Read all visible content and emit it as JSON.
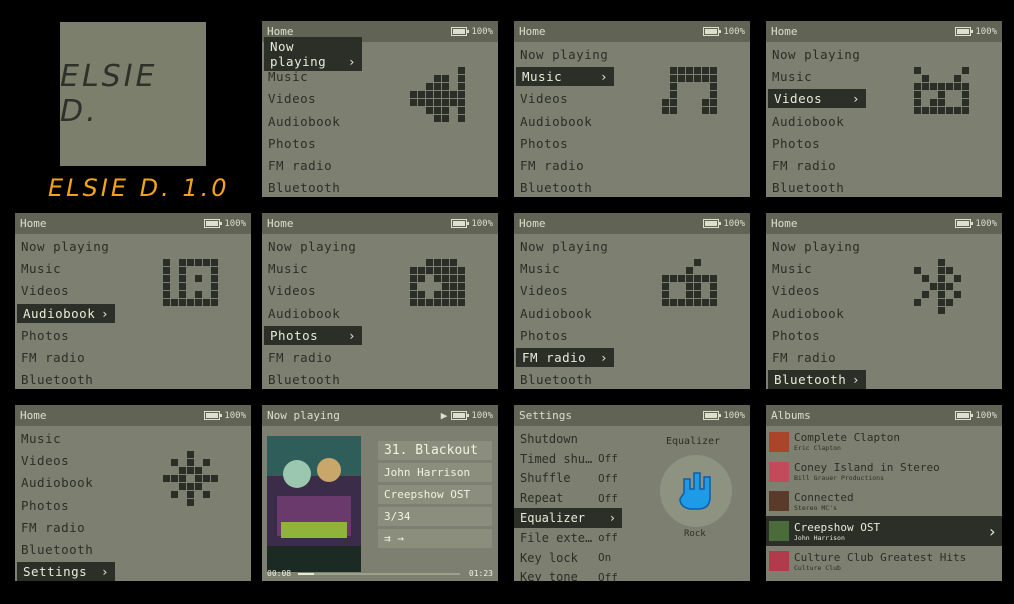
{
  "logo": {
    "screen_text": "ELSIE D.",
    "version_text": "ELSIE D. 1.0"
  },
  "colors": {
    "lcd": "#7d8070",
    "header": "#616454",
    "ink": "#2b2e27",
    "selection": "#2c2f28",
    "version": "#f2a31a"
  },
  "battery": "100%",
  "home": {
    "title": "Home",
    "items": [
      "Now playing",
      "Music",
      "Videos",
      "Audiobook",
      "Photos",
      "FM radio",
      "Bluetooth"
    ],
    "items_scrolled": [
      "Music",
      "Videos",
      "Audiobook",
      "Photos",
      "FM radio",
      "Bluetooth",
      "Settings"
    ]
  },
  "icons": [
    "speaker-icon",
    "music-note-icon",
    "tv-icon",
    "audiobook-icon",
    "camera-icon",
    "radio-icon",
    "bluetooth-icon",
    "settings-gear-icon"
  ],
  "now_playing": {
    "title": "Now playing",
    "track": "31. Blackout",
    "artist": "John Harrison",
    "album": "Creepshow OST",
    "position": "3/34",
    "elapsed": "00:08",
    "duration": "01:23",
    "progress": 0.1
  },
  "settings": {
    "title": "Settings",
    "rows": [
      {
        "label": "Shutdown",
        "value": ""
      },
      {
        "label": "Timed shu…",
        "value": "Off"
      },
      {
        "label": "Shuffle",
        "value": "Off"
      },
      {
        "label": "Repeat",
        "value": "Off"
      },
      {
        "label": "Equalizer",
        "value": ""
      },
      {
        "label": "File exte…",
        "value": "off"
      },
      {
        "label": "Key lock",
        "value": "On"
      },
      {
        "label": "Key tone",
        "value": "Off"
      }
    ],
    "panel_title": "Equalizer",
    "panel_value": "Rock"
  },
  "albums": {
    "title": "Albums",
    "items": [
      {
        "title": "Complete Clapton",
        "artist": "Eric Clapton"
      },
      {
        "title": "Coney Island in Stereo",
        "artist": "Bill Grauer Productions"
      },
      {
        "title": "Connected",
        "artist": "Stereo MC's"
      },
      {
        "title": "Creepshow OST",
        "artist": "John Harrison"
      },
      {
        "title": "Culture Club Greatest Hits",
        "artist": "Culture Club"
      }
    ]
  }
}
